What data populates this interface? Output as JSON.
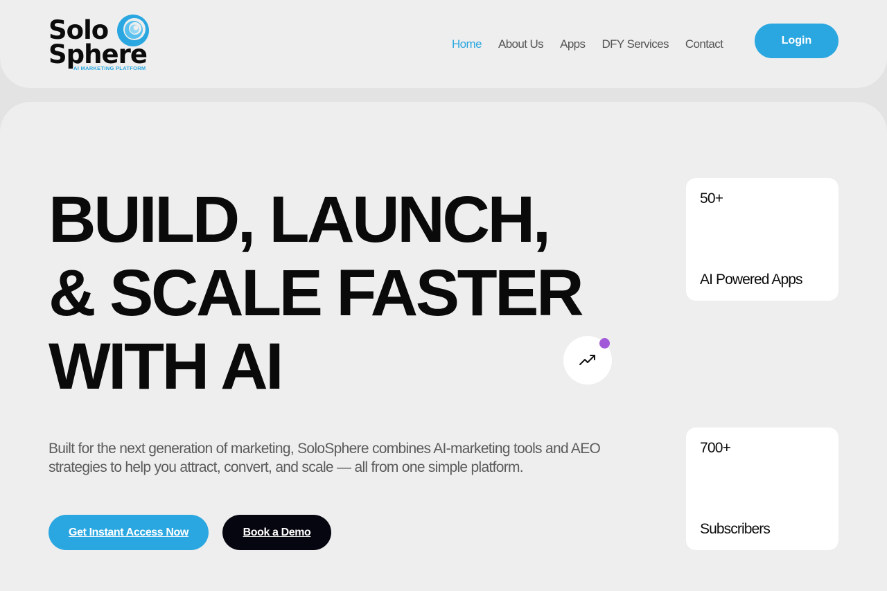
{
  "brand": {
    "line1": "Solo",
    "line2": "Sphere",
    "tagline": "AI MARKETING PLATFORM",
    "accent_color": "#2aa7e0"
  },
  "nav": {
    "items": [
      {
        "label": "Home",
        "active": true
      },
      {
        "label": "About Us",
        "active": false
      },
      {
        "label": "Apps",
        "active": false
      },
      {
        "label": "DFY Services",
        "active": false
      },
      {
        "label": "Contact",
        "active": false
      }
    ],
    "login_label": "Login"
  },
  "hero": {
    "headline": [
      "BUILD, LAUNCH,",
      "& SCALE FASTER",
      "WITH AI"
    ],
    "description": "Built for the next generation of marketing, SoloSphere combines AI-marketing tools and AEO strategies to help you attract, convert, and scale — all from one simple platform.",
    "primary_cta": "Get Instant Access Now",
    "secondary_cta": "Book a Demo",
    "badge_icon": "trending-up-icon",
    "badge_dot_color": "#a259d9"
  },
  "stats": [
    {
      "value": "50+",
      "label": "AI Powered Apps"
    },
    {
      "value": "700+",
      "label": "Subscribers"
    }
  ]
}
